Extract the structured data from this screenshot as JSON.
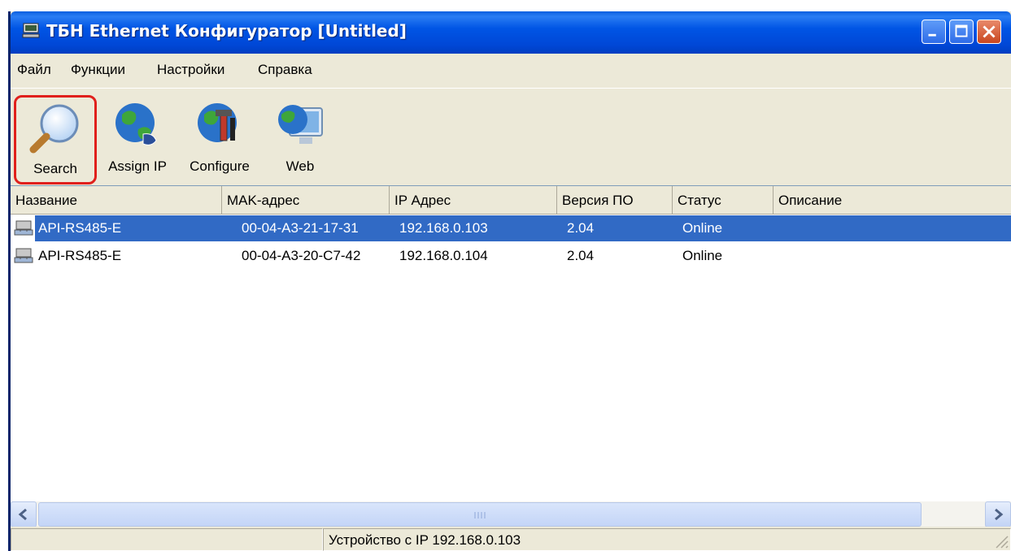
{
  "window": {
    "title": "ТБН Ethernet Конфигуратор [Untitled]"
  },
  "menu": [
    "Файл",
    "Функции",
    "Настройки",
    "Справка"
  ],
  "toolbar": {
    "search_label": "Search",
    "assign_ip_label": "Assign IP",
    "configure_label": "Configure",
    "web_label": "Web"
  },
  "list": {
    "columns": [
      "Название",
      "MAK-адрес",
      "IP Адрес",
      "Версия ПО",
      "Статус",
      "Описание"
    ],
    "rows": [
      {
        "name": "API-RS485-E",
        "mac": "00-04-A3-21-17-31",
        "ip": "192.168.0.103",
        "version": "2.04",
        "status": "Online",
        "description": ""
      },
      {
        "name": "API-RS485-E",
        "mac": "00-04-A3-20-C7-42",
        "ip": "192.168.0.104",
        "version": "2.04",
        "status": "Online",
        "description": ""
      }
    ],
    "selected_row": 0
  },
  "statusbar": {
    "left": "",
    "message": "Устройство с IP 192.168.0.103"
  },
  "colors": {
    "titlebar": "#0055e5",
    "selection": "#316ac5",
    "highlight_border": "#e0201c",
    "window_bg": "#ece9d8"
  },
  "icons": {
    "title": "network-device-icon",
    "search": "magnifier-icon",
    "assign_ip": "globe-network-icon",
    "configure": "globe-tools-icon",
    "web": "globe-monitor-icon",
    "row": "network-device-icon"
  }
}
